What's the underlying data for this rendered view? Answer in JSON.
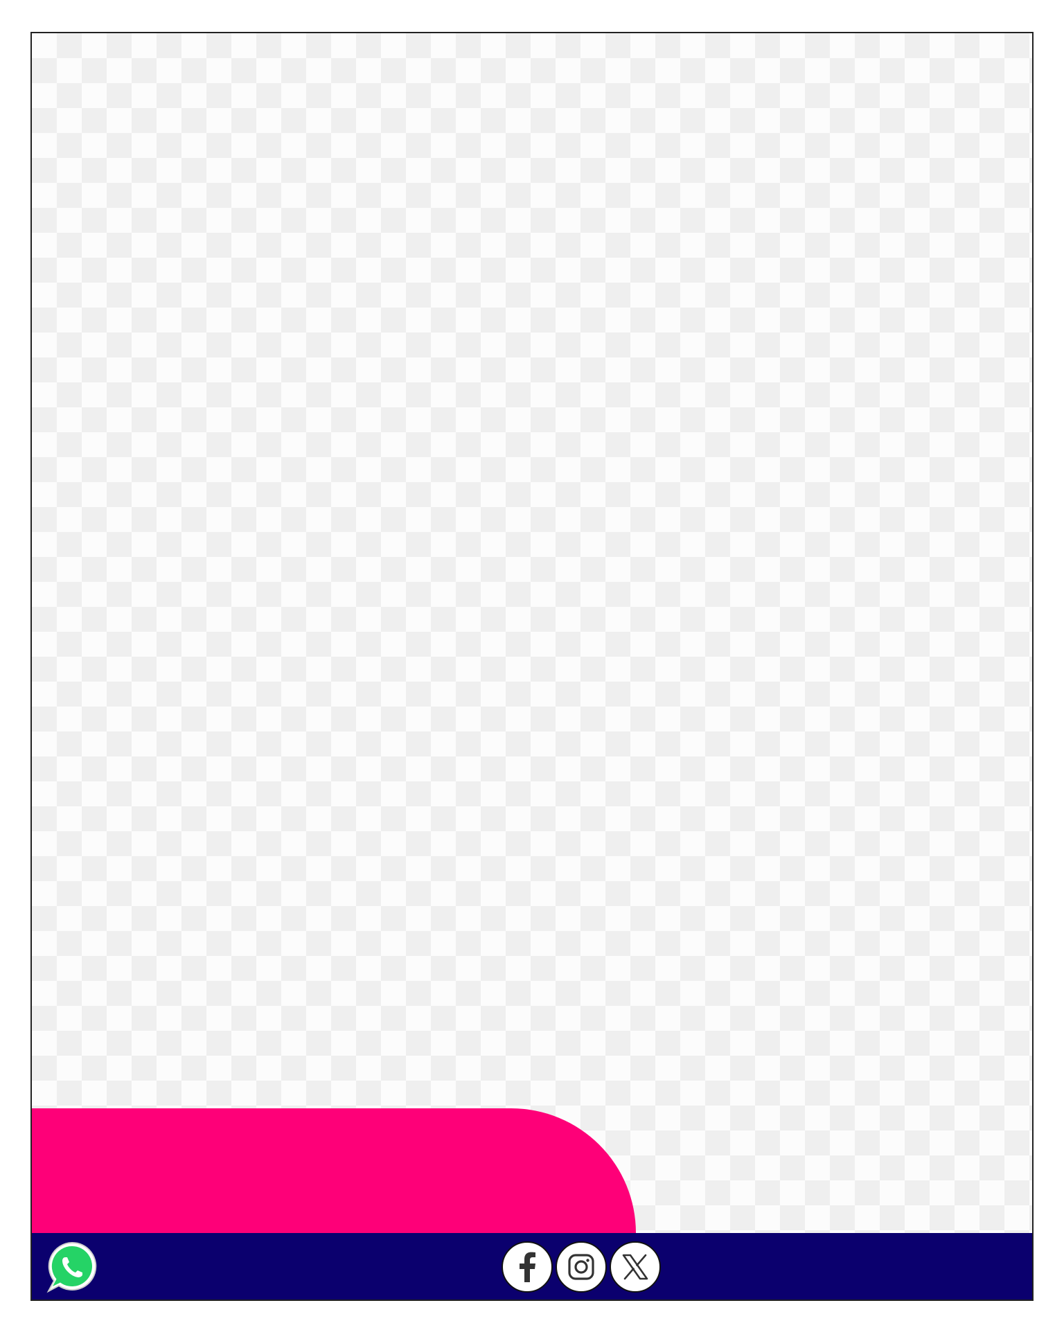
{
  "colors": {
    "accent_pink": "#fe0078",
    "footer_navy": "#0b006e",
    "whatsapp_green": "#25d366",
    "icon_dark": "#333333"
  },
  "footer": {
    "left_icon": "whatsapp-icon",
    "social_icons": [
      "facebook-icon",
      "instagram-icon",
      "x-icon"
    ]
  }
}
